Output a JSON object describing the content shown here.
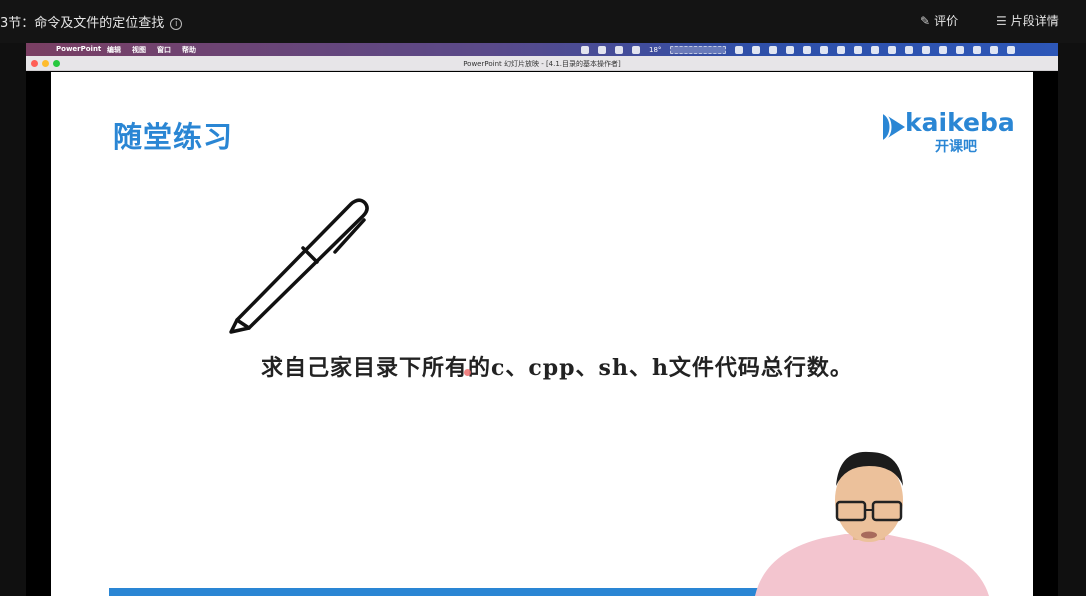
{
  "player": {
    "lesson_title": "3节：命令及文件的定位查找",
    "rate_label": "评价",
    "details_label": "片段详情"
  },
  "mac_menu": {
    "app": "PowerPoint",
    "items": [
      "编辑",
      "视图",
      "窗口",
      "帮助"
    ],
    "temperature": "18°"
  },
  "window": {
    "title": "PowerPoint 幻灯片放映 - [4.1.目录的基本操作者]"
  },
  "slide": {
    "heading": "随堂练习",
    "logo_wordmark": "kaikeba",
    "logo_cn": "开课吧",
    "question": "求自己家目录下所有的c、cpp、sh、h文件代码总行数。"
  },
  "colors": {
    "accent": "#2a86d4",
    "cursor": "#ef6e6e"
  },
  "icons": [
    "info-icon",
    "edit-icon",
    "list-icon",
    "apple-icon",
    "pen-icon"
  ]
}
